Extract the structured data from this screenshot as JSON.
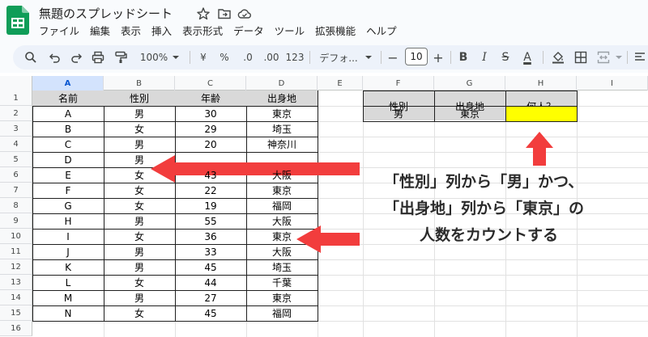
{
  "app": {
    "doc_title": "無題のスプレッドシート",
    "menus": [
      "ファイル",
      "編集",
      "表示",
      "挿入",
      "表示形式",
      "データ",
      "ツール",
      "拡張機能",
      "ヘルプ"
    ]
  },
  "toolbar": {
    "zoom": "100%",
    "currency": "¥",
    "percent": "%",
    "decrease_decimals": ".0",
    "increase_decimals": ".00",
    "number_format": "123",
    "font": "デフォ...",
    "font_size": "10",
    "minus": "−",
    "plus": "+",
    "bold": "B",
    "italic": "I",
    "strike": "S",
    "text_color": "A"
  },
  "grid": {
    "columns": [
      "A",
      "B",
      "C",
      "D",
      "E",
      "F",
      "G",
      "H",
      "I"
    ],
    "selected_column": "A",
    "rows": [
      "1",
      "2",
      "3",
      "4",
      "5",
      "6",
      "7",
      "8",
      "9",
      "10",
      "11",
      "12",
      "13",
      "14",
      "15",
      "16"
    ]
  },
  "table": {
    "headers": [
      "名前",
      "性別",
      "年齢",
      "出身地"
    ],
    "rows": [
      [
        "A",
        "男",
        "30",
        "東京"
      ],
      [
        "B",
        "女",
        "29",
        "埼玉"
      ],
      [
        "C",
        "男",
        "20",
        "神奈川"
      ],
      [
        "D",
        "男",
        "",
        ""
      ],
      [
        "E",
        "女",
        "43",
        "大阪"
      ],
      [
        "F",
        "女",
        "22",
        "東京"
      ],
      [
        "G",
        "女",
        "19",
        "福岡"
      ],
      [
        "H",
        "男",
        "55",
        "大阪"
      ],
      [
        "I",
        "女",
        "36",
        "東京"
      ],
      [
        "J",
        "男",
        "33",
        "大阪"
      ],
      [
        "K",
        "男",
        "45",
        "埼玉"
      ],
      [
        "L",
        "女",
        "44",
        "千葉"
      ],
      [
        "M",
        "男",
        "27",
        "東京"
      ],
      [
        "N",
        "女",
        "45",
        "福岡"
      ]
    ]
  },
  "criteria_table": {
    "headers": [
      "性別",
      "出身地",
      "何人？"
    ],
    "values": [
      "男",
      "東京",
      ""
    ]
  },
  "annotation": {
    "lines": [
      "「性別」列から「男」かつ、",
      "「出身地」列から「東京」の",
      "人数をカウントする"
    ],
    "arrow_color": "#f23d3d"
  },
  "colors": {
    "header_fill": "#d9d9d9",
    "highlight": "#ffff00",
    "selected_col": "#d3e3fd"
  }
}
